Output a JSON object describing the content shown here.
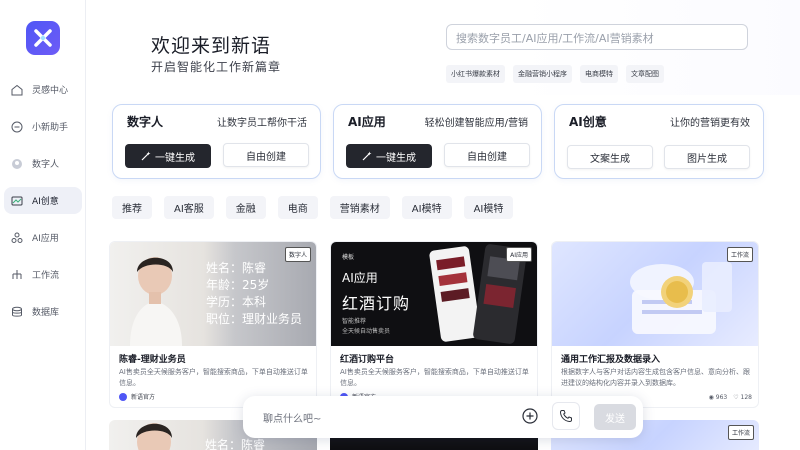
{
  "sidebar": {
    "items": [
      {
        "label": "灵感中心",
        "icon": "home-icon"
      },
      {
        "label": "小新助手",
        "icon": "assistant-icon"
      },
      {
        "label": "数字人",
        "icon": "digital-human-icon"
      },
      {
        "label": "AI创意",
        "icon": "creative-icon",
        "active": true
      },
      {
        "label": "AI应用",
        "icon": "apps-icon"
      },
      {
        "label": "工作流",
        "icon": "workflow-icon"
      },
      {
        "label": "数据库",
        "icon": "database-icon"
      }
    ]
  },
  "hero": {
    "title": "欢迎来到新语",
    "subtitle": "开启智能化工作新篇章"
  },
  "search": {
    "placeholder": "搜索数字员工/AI应用/工作流/AI营销素材",
    "tags": [
      "小红书爆款素材",
      "金融营销小程序",
      "电商模特",
      "文章配图"
    ]
  },
  "features": [
    {
      "title": "数字人",
      "desc": "让数字员工帮你干活",
      "primary": "一键生成",
      "secondary": "自由创建"
    },
    {
      "title": "AI应用",
      "desc": "轻松创建智能应用/营销",
      "primary": "一键生成",
      "secondary": "自由创建"
    },
    {
      "title": "AI创意",
      "desc": "让你的营销更有效",
      "btn1": "文案生成",
      "btn2": "图片生成"
    }
  ],
  "categories": [
    "推荐",
    "AI客服",
    "金融",
    "电商",
    "营销素材",
    "AI模特",
    "AI模特"
  ],
  "cards": [
    {
      "badge": "数字人",
      "title": "陈睿-理财业务员",
      "desc": "AI售卖员全天候服务客户，智能搜索商品，下单自动推送订单信息。",
      "author": "新语官方",
      "resume": [
        "姓名：陈睿",
        "年龄：25岁",
        "学历：本科",
        "职位：理财业务员"
      ]
    },
    {
      "badge": "AI应用",
      "title": "红酒订购平台",
      "desc": "AI售卖员全天候服务客户，智能搜索商品，下单自动推送订单信息。",
      "author": "新语官方",
      "poster_tag": "模板",
      "poster_title": "AI应用",
      "poster_big": "红酒订购",
      "poster_sub1": "智能推荐",
      "poster_sub2": "全天候自动售卖员"
    },
    {
      "badge": "工作流",
      "title": "通用工作汇报及数据录入",
      "desc": "根据数字人与客户对话内容生成包含客户信息、意向分析、跟进建议的结构化内容并录入到数据库。",
      "views": "963",
      "likes": "128"
    }
  ],
  "second_row": {
    "resume_partial": "姓名：陈睿",
    "badge": "工作流"
  },
  "chat": {
    "placeholder": "聊点什么吧~",
    "send": "发送"
  },
  "colors": {
    "brand": "#4f56f5",
    "dark_button": "#24262d",
    "card_border": "#c9d8f5"
  }
}
